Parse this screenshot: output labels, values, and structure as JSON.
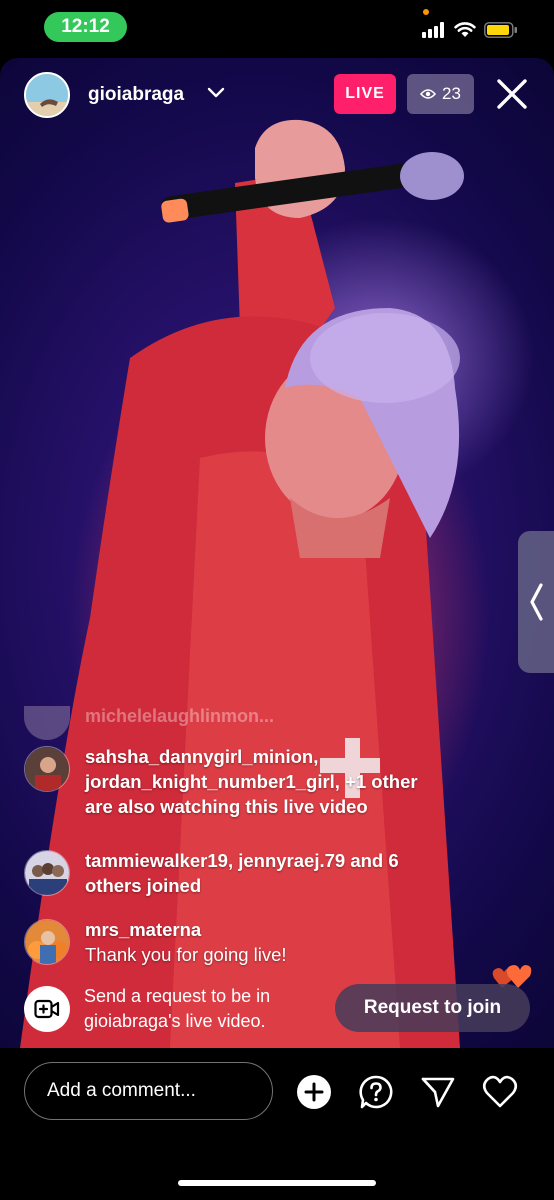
{
  "status_bar": {
    "time": "12:12"
  },
  "live": {
    "host_username": "gioiabraga",
    "live_label": "LIVE",
    "viewer_count": "23"
  },
  "comments": {
    "faded_partial": "michelelaughlinmon...",
    "items": [
      {
        "username": "sahsha_dannygirl_minion,",
        "text_line2": "jordan_knight_number1_girl, +1 other",
        "text_line3": "are also watching this live video"
      },
      {
        "username": "tammiewalker19, jennyraej.79 and 6",
        "text_line2": "others joined"
      },
      {
        "username": "mrs_materna",
        "message": "Thank you for going live!"
      }
    ]
  },
  "request": {
    "text_line1": "Send a request to be in",
    "text_line2": "gioiabraga's live video.",
    "button_label": "Request to join"
  },
  "bottom_bar": {
    "comment_placeholder": "Add a comment..."
  },
  "colors": {
    "live_badge": "#ff1f6b",
    "status_pill": "#34c759"
  },
  "icons": [
    "battery-icon",
    "wifi-icon",
    "signal-icon",
    "eye-icon",
    "close-icon",
    "chevron-down-icon",
    "chevron-left-icon",
    "video-add-icon",
    "add-icon",
    "question-icon",
    "send-icon",
    "heart-icon"
  ]
}
